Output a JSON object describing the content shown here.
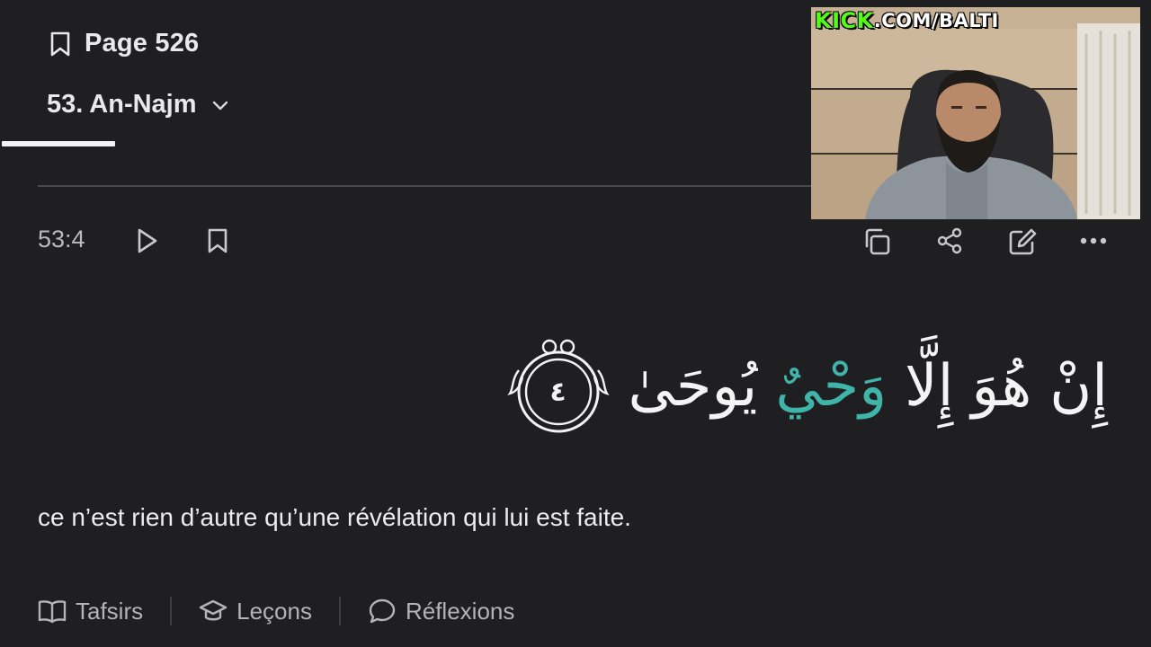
{
  "header": {
    "page_label": "Page 526",
    "surah_label": "53. An-Najm",
    "reading_progress": 0.1
  },
  "verse": {
    "reference": "53:4",
    "arabic_words": [
      "إِنْ",
      "هُوَ",
      "إِلَّا",
      "وَحْيٌ",
      "يُوحَىٰ"
    ],
    "highlighted_word_index": 3,
    "ayah_number": "٤",
    "translation": "ce n’est rien d’autre qu’une révélation qui lui est faite."
  },
  "tabs": [
    {
      "label": "Tafsirs",
      "icon": "book-open-icon"
    },
    {
      "label": "Leçons",
      "icon": "graduation-cap-icon"
    },
    {
      "label": "Réflexions",
      "icon": "chat-bubble-icon"
    }
  ],
  "webcam": {
    "brand": "KICK",
    "url_rest": ".COM/BALTI"
  },
  "colors": {
    "background": "#1f1f22",
    "highlight": "#3fb4a8",
    "kick_green": "#53fc18"
  }
}
